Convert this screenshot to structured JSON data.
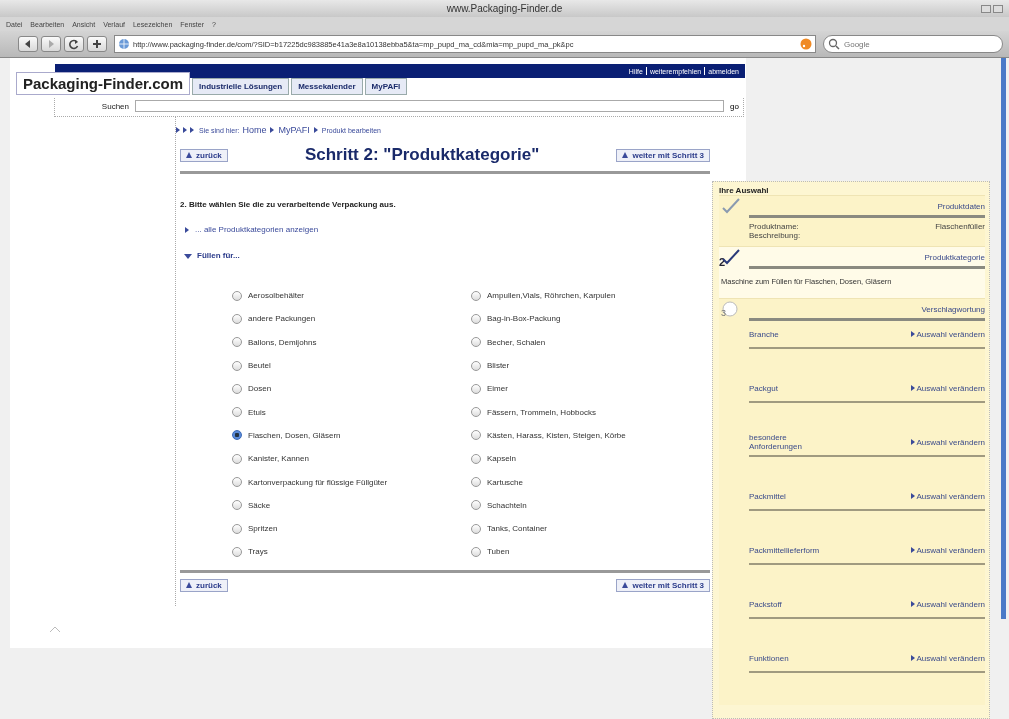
{
  "window": {
    "title": "www.Packaging-Finder.de"
  },
  "menu": [
    "Datei",
    "Bearbeiten",
    "Ansicht",
    "Verlauf",
    "Lesezeichen",
    "Fenster",
    "?"
  ],
  "toolbar": {
    "url": "http://www.packaging-finder.de/com/?SID=b17225dc983885e41a3e8a10138ebba5&ta=mp_pupd_ma_cd&mia=mp_pupd_ma_pk&pc",
    "search_placeholder": "Google"
  },
  "site": {
    "logo": "Packaging-Finder.com",
    "top_links": [
      "Hilfe",
      "weiterempfehlen",
      "abmelden"
    ],
    "tabs": [
      {
        "label": "Industrielle Lösungen",
        "selected": false
      },
      {
        "label": "Messekalender",
        "selected": false
      },
      {
        "label": "MyPAFI",
        "selected": false
      }
    ],
    "search": {
      "label": "Suchen",
      "button": "go"
    }
  },
  "breadcrumb": {
    "label": "Sie sind hier:",
    "items": [
      "Home",
      "MyPAFI",
      "Produkt bearbeiten"
    ]
  },
  "step": {
    "back": "zurück",
    "title": "Schritt 2: \"Produktkategorie\"",
    "next": "weiter mit Schritt 3",
    "back_bottom": "zurück",
    "next_bottom": "weiter mit Schritt 3",
    "question": "2. Bitte wählen Sie die zu verarbeitende Verpackung aus.",
    "show_all": "... alle Produktkategorien anzeigen",
    "group": {
      "label": "Füllen für...",
      "expanded": true
    },
    "options": [
      {
        "label": "Aerosolbehälter",
        "selected": false
      },
      {
        "label": "Ampullen,Vials, Röhrchen, Karpulen",
        "selected": false
      },
      {
        "label": "andere Packungen",
        "selected": false
      },
      {
        "label": "Bag-in-Box-Packung",
        "selected": false
      },
      {
        "label": "Ballons, Demijohns",
        "selected": false
      },
      {
        "label": "Becher, Schalen",
        "selected": false
      },
      {
        "label": "Beutel",
        "selected": false
      },
      {
        "label": "Blister",
        "selected": false
      },
      {
        "label": "Dosen",
        "selected": false
      },
      {
        "label": "Eimer",
        "selected": false
      },
      {
        "label": "Etuis",
        "selected": false
      },
      {
        "label": "Fässern, Trommeln, Hobbocks",
        "selected": false
      },
      {
        "label": "Flaschen, Dosen, Gläsern",
        "selected": true
      },
      {
        "label": "Kästen, Harass, Kisten, Steigen, Körbe",
        "selected": false
      },
      {
        "label": "Kanister, Kannen",
        "selected": false
      },
      {
        "label": "Kapseln",
        "selected": false
      },
      {
        "label": "Kartonverpackung für flüssige Füllgüter",
        "selected": false
      },
      {
        "label": "Kartusche",
        "selected": false
      },
      {
        "label": "Säcke",
        "selected": false
      },
      {
        "label": "Schachteln",
        "selected": false
      },
      {
        "label": "Spritzen",
        "selected": false
      },
      {
        "label": "Tanks, Container",
        "selected": false
      },
      {
        "label": "Trays",
        "selected": false
      },
      {
        "label": "Tuben",
        "selected": false
      }
    ]
  },
  "sidebar": {
    "title": "Ihre Auswahl",
    "sections": [
      {
        "heading": "Produktdaten",
        "completed": true,
        "current": false,
        "kind": "fields",
        "fields": [
          {
            "label": "Produktname:",
            "value": "Flaschenfüller"
          },
          {
            "label": "Beschreibung:"
          }
        ]
      },
      {
        "heading": "Produktkategorie",
        "completed": true,
        "current": true,
        "number": "2",
        "kind": "text",
        "text": "Maschine zum Füllen für Flaschen, Dosen, Gläsern"
      },
      {
        "heading": "Verschlagwortung",
        "completed": false,
        "current": false,
        "number": "3",
        "kind": "links",
        "links": [
          {
            "label": "Branche",
            "action": "Auswahl verändern"
          },
          {
            "label": "Packgut",
            "action": "Auswahl verändern"
          },
          {
            "label": "besondere Anforderungen",
            "action": "Auswahl verändern"
          },
          {
            "label": "Packmittel",
            "action": "Auswahl verändern"
          },
          {
            "label": "Packmittellieferform",
            "action": "Auswahl verändern"
          },
          {
            "label": "Packstoff",
            "action": "Auswahl verändern"
          },
          {
            "label": "Funktionen",
            "action": "Auswahl verändern"
          }
        ]
      }
    ]
  }
}
